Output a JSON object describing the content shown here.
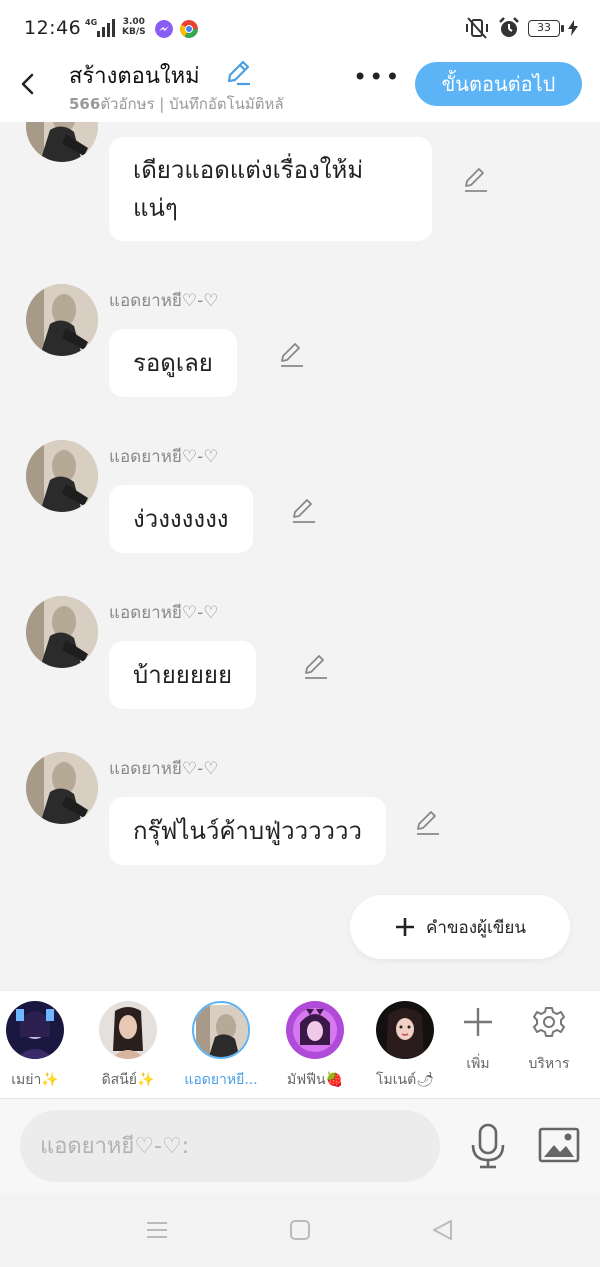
{
  "status_bar": {
    "time": "12:46",
    "network": "4G",
    "speed_value": "3.00",
    "speed_unit": "KB/S",
    "battery": "33"
  },
  "header": {
    "title": "สร้างตอนใหม่",
    "char_count": "566",
    "subtitle": "ตัวอักษร | บันทึกอัตโนมัติหลั",
    "next_button": "ขั้นตอนต่อไป",
    "more_label": "•••"
  },
  "messages": [
    {
      "sender": "",
      "text_line1": "เดียวแอดแต่งเรื่องให้ม่",
      "text_line2": "แน่ๆ"
    },
    {
      "sender": "แอดยาหยี♡-♡",
      "text": "รอดูเลย"
    },
    {
      "sender": "แอดยาหยี♡-♡",
      "text": "ง่วงงงงงง"
    },
    {
      "sender": "แอดยาหยี♡-♡",
      "text": "บ้ายยยยย"
    },
    {
      "sender": "แอดยาหยี♡-♡",
      "text": "กรุ๊ฟไนว์ค้าบฟู่วววววว"
    }
  ],
  "author_note_button": "คำของผู้เขียน",
  "characters": [
    {
      "name": "เมย่า✨"
    },
    {
      "name": "ดิสนีย์✨"
    },
    {
      "name": "แอดยาหยี..."
    },
    {
      "name": "มัฟฟีน🍓"
    },
    {
      "name": "โมเนต์🌶"
    }
  ],
  "tools": {
    "add_label": "เพิ่ม",
    "manage_label": "บริหาร"
  },
  "input": {
    "placeholder": "แอดยาหยี♡-♡:"
  },
  "colors": {
    "accent": "#5cb3f5",
    "background": "#f3f3f3",
    "bubble": "#ffffff"
  }
}
